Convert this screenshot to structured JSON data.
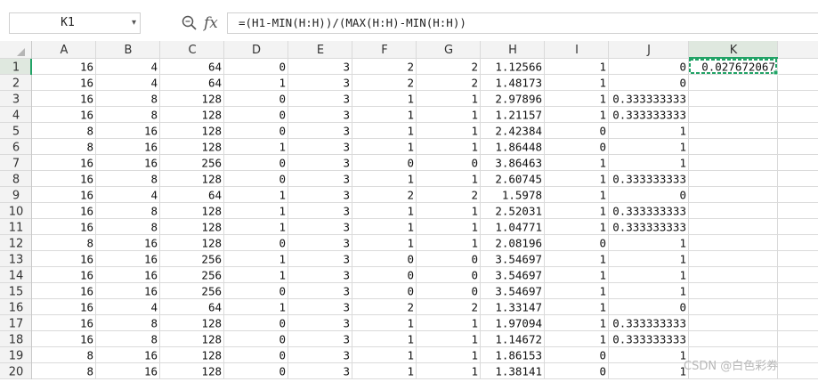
{
  "formula_bar": {
    "name_box": "K1",
    "fx_label": "fx",
    "formula": "=(H1-MIN(H:H))/(MAX(H:H)-MIN(H:H))"
  },
  "sheet": {
    "selected_cell": "K1",
    "columns": [
      "A",
      "B",
      "C",
      "D",
      "E",
      "F",
      "G",
      "H",
      "I",
      "J",
      "K"
    ],
    "row_numbers": [
      "1",
      "2",
      "3",
      "4",
      "5",
      "6",
      "7",
      "8",
      "9",
      "10",
      "11",
      "12",
      "13",
      "14",
      "15",
      "16",
      "17",
      "18",
      "19",
      "20"
    ],
    "rows": [
      [
        "16",
        "4",
        "64",
        "0",
        "3",
        "2",
        "2",
        "1.12566",
        "1",
        "0",
        "0.027672067"
      ],
      [
        "16",
        "4",
        "64",
        "1",
        "3",
        "2",
        "2",
        "1.48173",
        "1",
        "0",
        ""
      ],
      [
        "16",
        "8",
        "128",
        "0",
        "3",
        "1",
        "1",
        "2.97896",
        "1",
        "0.333333333",
        ""
      ],
      [
        "16",
        "8",
        "128",
        "0",
        "3",
        "1",
        "1",
        "1.21157",
        "1",
        "0.333333333",
        ""
      ],
      [
        "8",
        "16",
        "128",
        "0",
        "3",
        "1",
        "1",
        "2.42384",
        "0",
        "1",
        ""
      ],
      [
        "8",
        "16",
        "128",
        "1",
        "3",
        "1",
        "1",
        "1.86448",
        "0",
        "1",
        ""
      ],
      [
        "16",
        "16",
        "256",
        "0",
        "3",
        "0",
        "0",
        "3.86463",
        "1",
        "1",
        ""
      ],
      [
        "16",
        "8",
        "128",
        "0",
        "3",
        "1",
        "1",
        "2.60745",
        "1",
        "0.333333333",
        ""
      ],
      [
        "16",
        "4",
        "64",
        "1",
        "3",
        "2",
        "2",
        "1.5978",
        "1",
        "0",
        ""
      ],
      [
        "16",
        "8",
        "128",
        "1",
        "3",
        "1",
        "1",
        "2.52031",
        "1",
        "0.333333333",
        ""
      ],
      [
        "16",
        "8",
        "128",
        "1",
        "3",
        "1",
        "1",
        "1.04771",
        "1",
        "0.333333333",
        ""
      ],
      [
        "8",
        "16",
        "128",
        "0",
        "3",
        "1",
        "1",
        "2.08196",
        "0",
        "1",
        ""
      ],
      [
        "16",
        "16",
        "256",
        "1",
        "3",
        "0",
        "0",
        "3.54697",
        "1",
        "1",
        ""
      ],
      [
        "16",
        "16",
        "256",
        "1",
        "3",
        "0",
        "0",
        "3.54697",
        "1",
        "1",
        ""
      ],
      [
        "16",
        "16",
        "256",
        "0",
        "3",
        "0",
        "0",
        "3.54697",
        "1",
        "1",
        ""
      ],
      [
        "16",
        "4",
        "64",
        "1",
        "3",
        "2",
        "2",
        "1.33147",
        "1",
        "0",
        ""
      ],
      [
        "16",
        "8",
        "128",
        "0",
        "3",
        "1",
        "1",
        "1.97094",
        "1",
        "0.333333333",
        ""
      ],
      [
        "16",
        "8",
        "128",
        "0",
        "3",
        "1",
        "1",
        "1.14672",
        "1",
        "0.333333333",
        ""
      ],
      [
        "8",
        "16",
        "128",
        "0",
        "3",
        "1",
        "1",
        "1.86153",
        "0",
        "1",
        ""
      ],
      [
        "8",
        "16",
        "128",
        "0",
        "3",
        "1",
        "1",
        "1.38141",
        "0",
        "1",
        ""
      ]
    ]
  },
  "watermark": "CSDN @白色彩券",
  "colors": {
    "selection": "#21a366",
    "header_bg": "#f3f3f3",
    "selected_header_bg": "#dfe8df",
    "grid_line": "#dadada"
  },
  "icons": {
    "zoom": "zoom-icon",
    "dropdown": "chevron-down-icon",
    "select_all": "select-all-triangle-icon"
  }
}
